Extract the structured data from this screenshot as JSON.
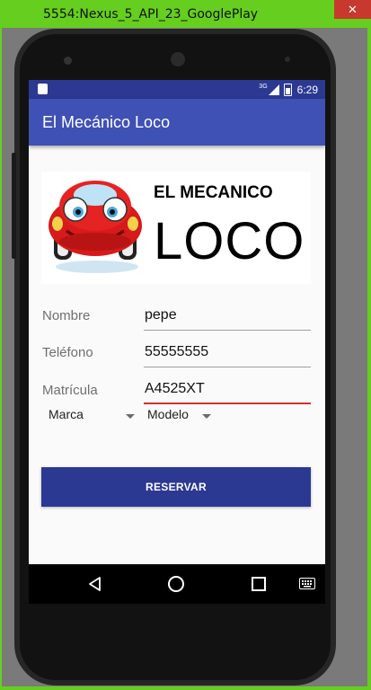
{
  "window": {
    "title": "5554:Nexus_5_API_23_GooglePlay",
    "close_glyph": "✕"
  },
  "status_bar": {
    "network": "3G",
    "time": "6:29"
  },
  "app_bar": {
    "title": "El Mecánico Loco"
  },
  "logo": {
    "line1": "EL MECANICO",
    "line2": "LOCO"
  },
  "form": {
    "nombre": {
      "label": "Nombre",
      "value": "pepe"
    },
    "telefono": {
      "label": "Teléfono",
      "value": "55555555"
    },
    "matricula": {
      "label": "Matrícula",
      "value": "A4525XT"
    },
    "marca": {
      "selected": "Marca"
    },
    "modelo": {
      "selected": "Modelo"
    },
    "reserve_label": "RESERVAR"
  },
  "colors": {
    "primary": "#3f51b5",
    "primary_dark": "#2c3993",
    "accent_error": "#d32f2f",
    "window_frame": "#66ce1e"
  }
}
